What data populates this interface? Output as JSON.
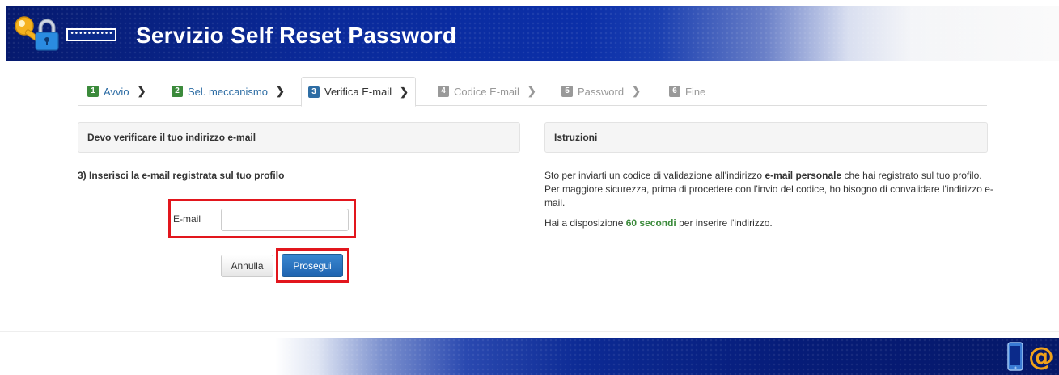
{
  "header": {
    "title": "Servizio Self Reset Password",
    "password_mask": "••••••••••"
  },
  "steps": [
    {
      "number": "1",
      "label": "Avvio",
      "state": "done"
    },
    {
      "number": "2",
      "label": "Sel. meccanismo",
      "state": "done"
    },
    {
      "number": "3",
      "label": "Verifica E-mail",
      "state": "active"
    },
    {
      "number": "4",
      "label": "Codice E-mail",
      "state": "todo"
    },
    {
      "number": "5",
      "label": "Password",
      "state": "todo"
    },
    {
      "number": "6",
      "label": "Fine",
      "state": "todo"
    }
  ],
  "left_panel": {
    "heading": "Devo verificare il tuo indirizzo e-mail",
    "section_title": "3) Inserisci la e-mail registrata sul tuo profilo",
    "email_label": "E-mail",
    "email_value": "",
    "cancel_label": "Annulla",
    "next_label": "Prosegui"
  },
  "right_panel": {
    "heading": "Istruzioni",
    "p1_before": "Sto per inviarti un codice di validazione all'indirizzo ",
    "p1_bold": "e-mail personale",
    "p1_after": " che hai registrato sul tuo profilo.",
    "p2": "Per maggiore sicurezza, prima di procedere con l'invio del codice, ho bisogno di convalidare l'indirizzo e-mail.",
    "p3_before": "Hai a disposizione ",
    "p3_highlight": "60 secondi",
    "p3_after": " per inserire l'indirizzo."
  },
  "footer": {
    "icons": [
      "phone-icon",
      "at-icon"
    ],
    "at_symbol": "@"
  },
  "colors": {
    "accent_blue": "#2e6da4",
    "done_green": "#3b8a3b",
    "highlight_red": "#e2161d"
  }
}
